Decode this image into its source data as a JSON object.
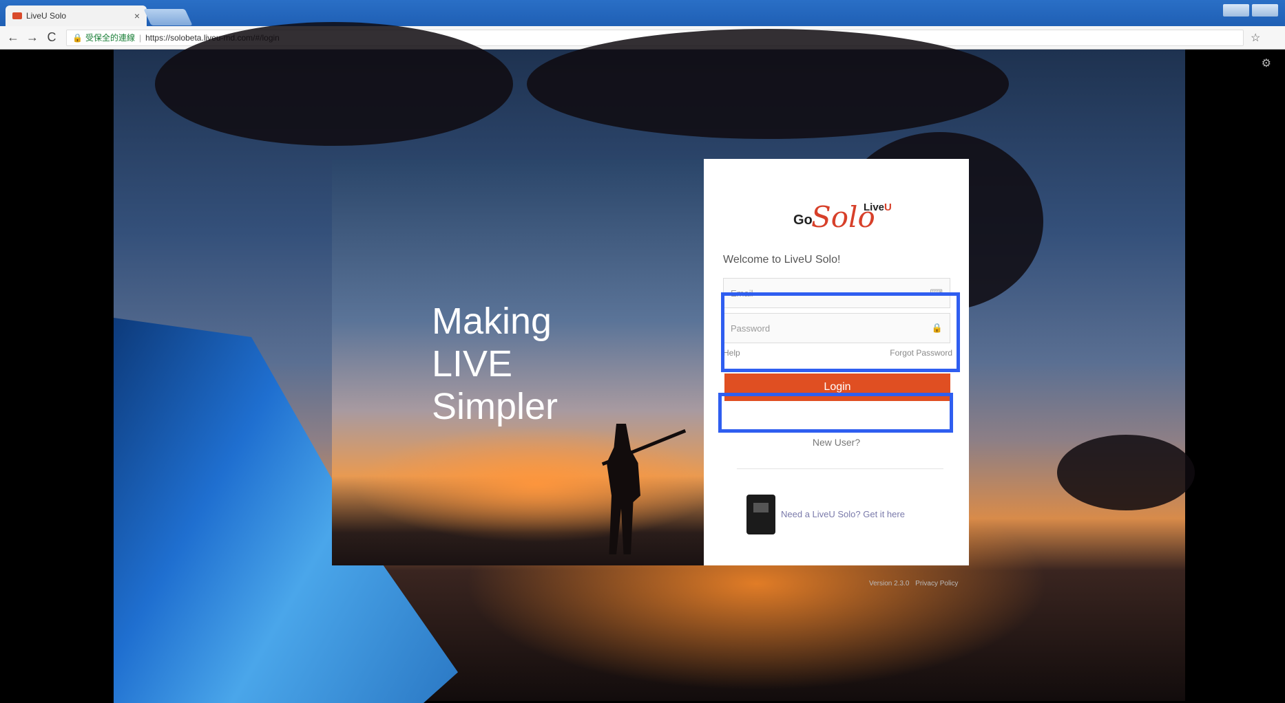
{
  "browser": {
    "tab_title": "LiveU Solo",
    "tab_close": "×",
    "back": "←",
    "forward": "→",
    "reload": "C",
    "lock_icon": "🔒",
    "secure_label": "受保全的連線",
    "url": "https://solobeta.liveu-md.com/#/login",
    "bookmark_star": "☆"
  },
  "hero": {
    "line1": "Making",
    "line2": "LIVE",
    "line3": "Simpler"
  },
  "logo": {
    "go": "Go",
    "solo": "Solo",
    "live": "Live",
    "u": "U"
  },
  "login": {
    "welcome": "Welcome to LiveU Solo!",
    "email_placeholder": "Email",
    "password_placeholder": "Password",
    "help": "Help",
    "forgot": "Forgot Password",
    "login_button": "Login",
    "new_user": "New User?",
    "get_it": "Need a LiveU Solo? Get it here"
  },
  "footer": {
    "version": "Version 2.3.0",
    "privacy": "Privacy Policy"
  },
  "colors": {
    "accent": "#e04f22",
    "highlight": "#2f5ef0"
  }
}
